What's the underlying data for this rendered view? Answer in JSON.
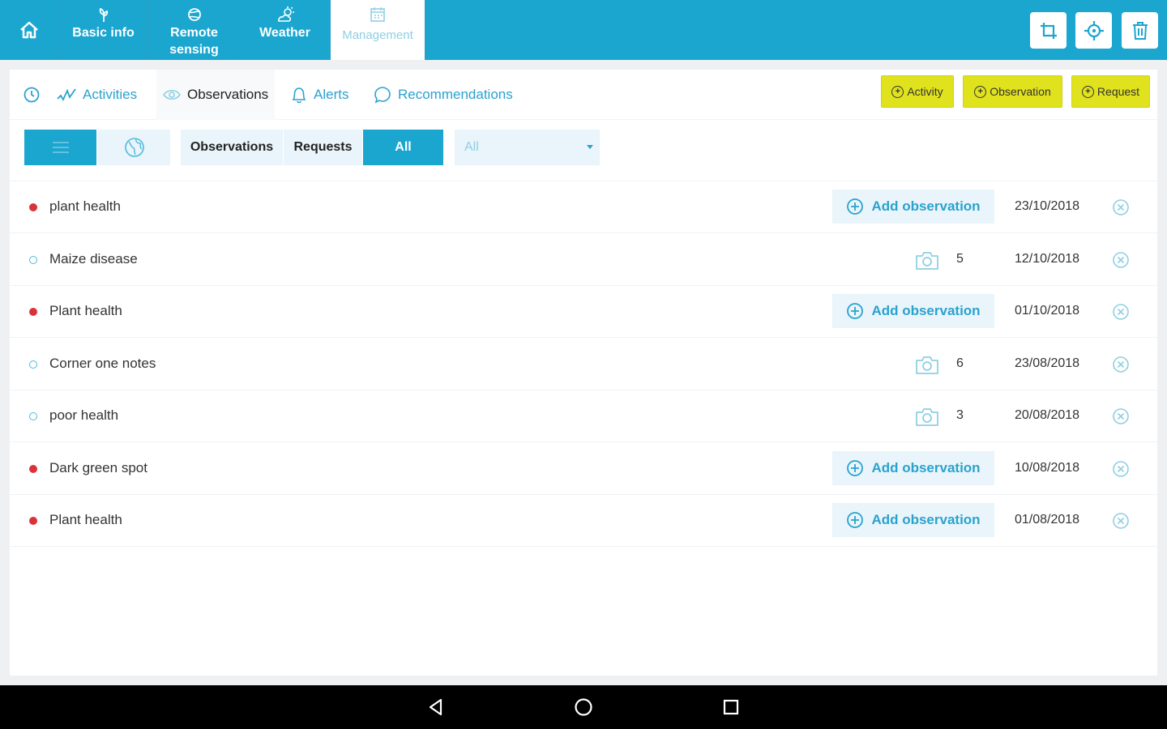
{
  "nav": {
    "tabs": [
      {
        "label": "Basic info",
        "icon": "plant-icon"
      },
      {
        "label": "Remote sensing",
        "label_line1": "Remote",
        "label_line2": "sensing",
        "icon": "satellite-icon"
      },
      {
        "label": "Weather",
        "icon": "cloud-sun-icon"
      },
      {
        "label": "Management",
        "icon": "calendar-icon",
        "active": true
      }
    ],
    "actions": [
      "crop-icon",
      "locate-icon",
      "trash-icon"
    ]
  },
  "subtabs": [
    {
      "label": "Activities",
      "icon": "activity-icon"
    },
    {
      "label": "Observations",
      "icon": "eye-icon",
      "active": true
    },
    {
      "label": "Alerts",
      "icon": "bell-icon"
    },
    {
      "label": "Recommendations",
      "icon": "chat-icon"
    }
  ],
  "add_buttons": {
    "activity": "Activity",
    "observation": "Observation",
    "request": "Request"
  },
  "filters": {
    "observations": "Observations",
    "requests": "Requests",
    "all": "All",
    "dropdown_value": "All"
  },
  "rows": [
    {
      "title": "plant health",
      "status": "request",
      "action": "Add observation",
      "date": "23/10/2018"
    },
    {
      "title": "Maize disease",
      "status": "observation",
      "photos": "5",
      "date": "12/10/2018"
    },
    {
      "title": "Plant health",
      "status": "request",
      "action": "Add observation",
      "date": "01/10/2018"
    },
    {
      "title": "Corner one notes",
      "status": "observation",
      "photos": "6",
      "date": "23/08/2018"
    },
    {
      "title": "poor health",
      "status": "observation",
      "photos": "3",
      "date": "20/08/2018"
    },
    {
      "title": "Dark  green spot",
      "status": "request",
      "action": "Add observation",
      "date": "10/08/2018"
    },
    {
      "title": "Plant health",
      "status": "request",
      "action": "Add observation",
      "date": "01/08/2018"
    }
  ],
  "colors": {
    "primary": "#1ba6d0",
    "accent_yellow": "#dfe21c",
    "request_dot": "#d9323a"
  }
}
